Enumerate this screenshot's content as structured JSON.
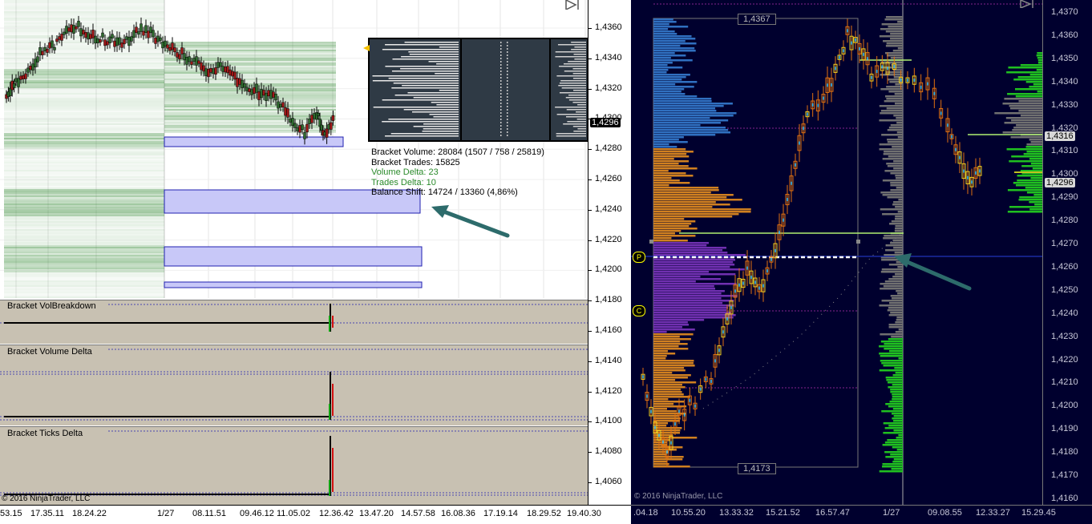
{
  "left_chart": {
    "price_axis": [
      "1,4360",
      "1,4340",
      "1,4320",
      "1,4300",
      "1,4280",
      "1,4260",
      "1,4240",
      "1,4220",
      "1,4200",
      "1,4180",
      "1,4160",
      "1,4140",
      "1,4120",
      "1,4100",
      "1,4080",
      "1,4060"
    ],
    "current_price": "1,4296",
    "time_axis": [
      "53.15",
      "17.35.11",
      "18.24.22",
      "1/27",
      "08.11.51",
      "09.46.12",
      "11.05.02",
      "12.36.42",
      "13.47.20",
      "14.57.58",
      "16.08.36",
      "17.19.14",
      "18.29.52",
      "19.40.30"
    ],
    "info": {
      "bracket_volume": "Bracket Volume: 28084 (1507 / 758 / 25819)",
      "bracket_trades": "Bracket Trades: 15825",
      "volume_delta": "Volume Delta: 23",
      "trades_delta": "Trades Delta: 10",
      "balance_shift": "Balance Shift: 14724 / 13360 (4,86%)"
    },
    "panels": {
      "vol_breakdown": "Bracket VolBreakdown",
      "volume_delta": "Bracket Volume Delta",
      "ticks_delta": "Bracket Ticks Delta"
    },
    "copyright": "© 2016 NinjaTrader, LLC"
  },
  "right_chart": {
    "price_axis": [
      "1,4370",
      "1,4360",
      "1,4350",
      "1,4340",
      "1,4330",
      "1,4320",
      "1,4310",
      "1,4300",
      "1,4290",
      "1,4280",
      "1,4270",
      "1,4260",
      "1,4250",
      "1,4240",
      "1,4230",
      "1,4220",
      "1,4210",
      "1,4200",
      "1,4190",
      "1,4180",
      "1,4170",
      "1,4160"
    ],
    "tag_high": "1,4316",
    "tag_current": "1,4296",
    "range_high": "1,4367",
    "range_low": "1,4173",
    "marker_p": "P",
    "marker_c": "C",
    "time_axis": [
      ".04.18",
      "10.55.20",
      "13.33.32",
      "15.21.52",
      "16.57.47",
      "1/27",
      "09.08.55",
      "12.33.27",
      "15.29.45"
    ],
    "copyright": "© 2016 NinjaTrader, LLC"
  },
  "colors": {
    "candle_up": "#2e6b2e",
    "candle_down": "#a01818",
    "profile_green": "#1e7d1e",
    "bracket_blue": "#c8c8f8",
    "right_bg": "#00002e",
    "arrow": "#2d6b6b"
  }
}
